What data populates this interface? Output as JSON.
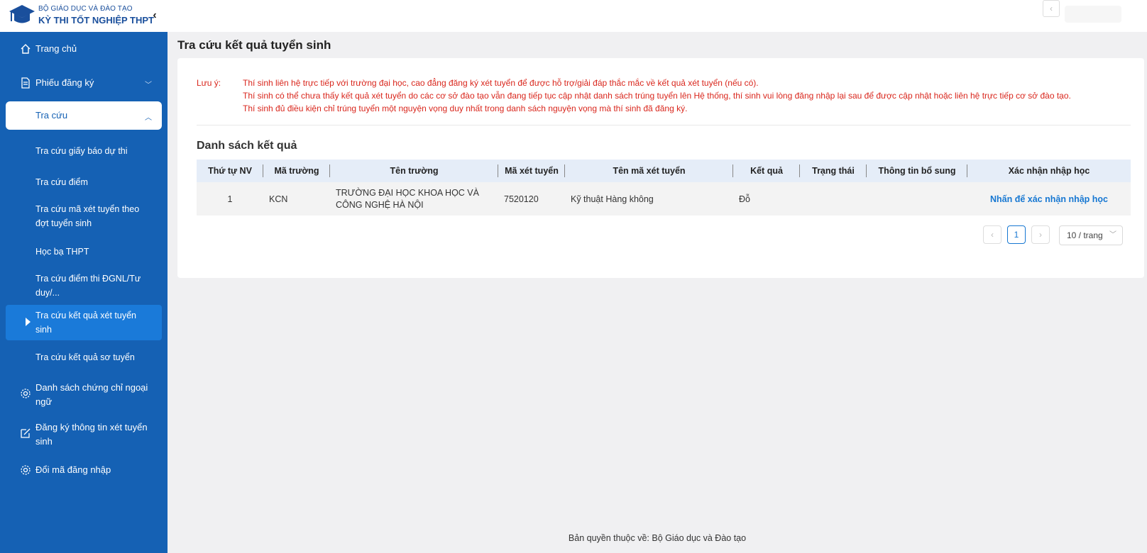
{
  "header": {
    "brand_line1": "BỘ GIÁO DỤC VÀ ĐÀO TẠO",
    "brand_line2": "KỲ THI TỐT NGHIỆP THPT",
    "collapse_glyph": "‹",
    "top_right_glyph": "‹",
    "accent_color": "#1561b4"
  },
  "sidebar": {
    "items": [
      {
        "label": "Trang chủ",
        "icon": "home-icon"
      },
      {
        "label": "Phiếu đăng ký",
        "icon": "document-icon",
        "chevron": "﹀"
      },
      {
        "label": "Tra cứu",
        "chevron": "︿"
      }
    ],
    "sub_items": [
      {
        "label": "Tra cứu giấy báo dự thi"
      },
      {
        "label": "Tra cứu điểm"
      },
      {
        "label": "Tra cứu mã xét tuyển theo đợt tuyển sinh"
      },
      {
        "label": "Học bạ THPT"
      },
      {
        "label": "Tra cứu điểm thi ĐGNL/Tư duy/..."
      },
      {
        "label": "Tra cứu kết quả xét tuyển sinh"
      },
      {
        "label": "Tra cứu kết quả sơ tuyển"
      }
    ],
    "bottom_items": [
      {
        "label": "Danh sách chứng chỉ ngoại ngữ",
        "icon": "gear-icon"
      },
      {
        "label": "Đăng ký thông tin xét tuyển sinh",
        "icon": "edit-icon"
      },
      {
        "label": "Đổi mã đăng nhập",
        "icon": "gear-icon"
      }
    ]
  },
  "main": {
    "title": "Tra cứu kết quả tuyển sinh",
    "note_label": "Lưu ý:",
    "notes": [
      "Thí sinh liên hệ trực tiếp với trường đại học, cao đẳng đăng ký xét tuyển để được hỗ trợ/giải đáp thắc mắc về kết quả xét tuyển (nếu có).",
      "Thí sinh có thể chưa thấy kết quả xét tuyển do các cơ sở đào tạo vẫn đang tiếp tục cập nhật danh sách trúng tuyển lên Hệ thống, thí sinh vui lòng đăng nhập lại sau để được cập nhật hoặc liên hệ trực tiếp cơ sở đào tạo.",
      "Thí sinh đủ điều kiện chỉ trúng tuyển một nguyện vọng duy nhất trong danh sách nguyện vọng mà thí sinh đã đăng ký."
    ],
    "section_title": "Danh sách kết quả",
    "table": {
      "columns": [
        "Thứ tự NV",
        "Mã trường",
        "Tên trường",
        "Mã xét tuyển",
        "Tên mã xét tuyển",
        "Kết quả",
        "Trạng thái",
        "Thông tin bổ sung",
        "Xác nhận nhập học"
      ],
      "rows": [
        {
          "order": "1",
          "school_code": "KCN",
          "school_name": "TRƯỜNG ĐẠI HỌC KHOA HỌC VÀ CÔNG NGHỆ HÀ NỘI",
          "admission_code": "7520120",
          "admission_name": "Kỹ thuật Hàng không",
          "result": "Đỗ",
          "status": "",
          "extra": "",
          "confirm_link": "Nhấn để xác nhận nhập học"
        }
      ]
    },
    "pagination": {
      "prev": "‹",
      "current": "1",
      "next": "›",
      "page_size": "10 / trang",
      "page_size_caret": "﹀"
    }
  },
  "footer": {
    "text": "Bản quyền thuộc về: Bộ Giáo dục và Đào tạo"
  }
}
